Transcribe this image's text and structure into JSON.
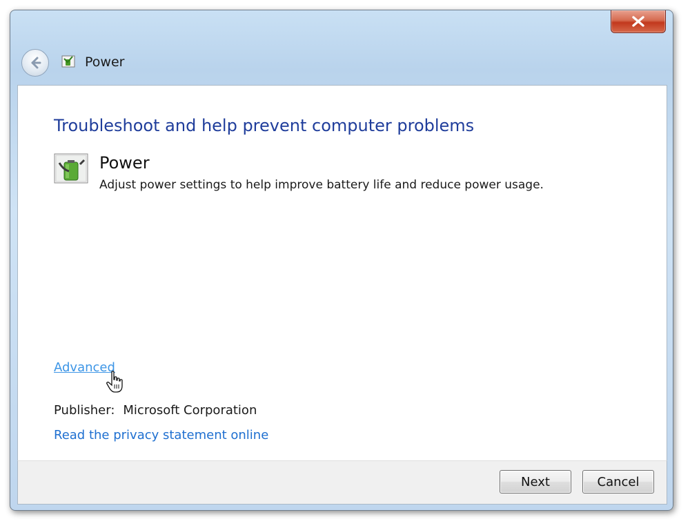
{
  "window": {
    "title": "Power",
    "close_icon": "close-icon",
    "back_icon": "back-arrow-icon"
  },
  "main": {
    "heading": "Troubleshoot and help prevent computer problems",
    "troubleshooter": {
      "icon": "power-battery-icon",
      "title": "Power",
      "description": "Adjust power settings to help improve battery life and reduce power usage."
    },
    "advanced_link": "Advanced",
    "publisher_label": "Publisher:",
    "publisher_value": "Microsoft Corporation",
    "privacy_link": "Read the privacy statement online"
  },
  "footer": {
    "next_label": "Next",
    "cancel_label": "Cancel"
  },
  "colors": {
    "heading": "#1f3d9b",
    "link": "#1e6fd0",
    "link_hover": "#3c95e6"
  }
}
